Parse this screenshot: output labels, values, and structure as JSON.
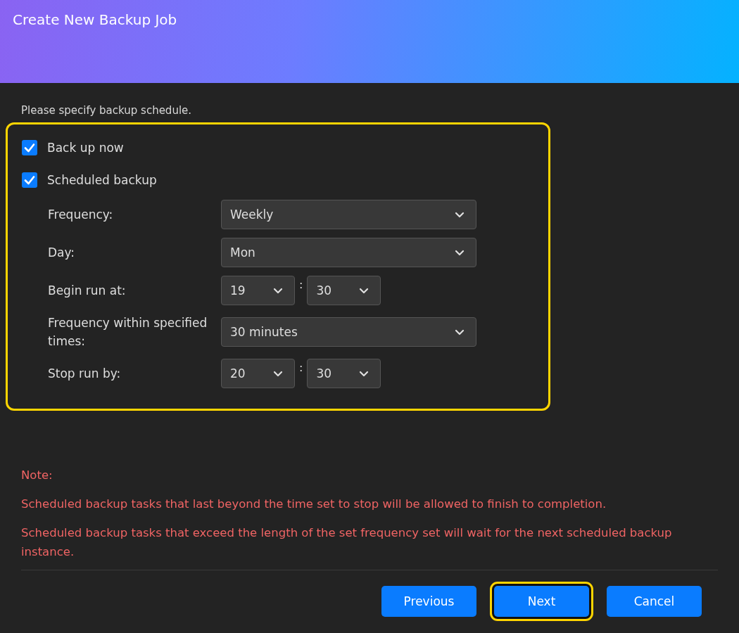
{
  "window": {
    "title": "Create New Backup Job"
  },
  "intro": "Please specify backup schedule.",
  "schedule_group": {
    "highlighted": true,
    "options": [
      {
        "label": "Back up now",
        "checked": true
      },
      {
        "label": "Scheduled backup",
        "checked": true
      }
    ],
    "fields": [
      {
        "kind": "select",
        "label": "Frequency:",
        "value": "Weekly"
      },
      {
        "kind": "select",
        "label": "Day:",
        "value": "Mon"
      },
      {
        "kind": "time",
        "label": "Begin run at:",
        "hour": "19",
        "separator": ":",
        "minute": "30"
      },
      {
        "kind": "select",
        "label": "Frequency within specified times:",
        "value": "30 minutes"
      },
      {
        "kind": "time",
        "label": "Stop run by:",
        "hour": "20",
        "separator": ":",
        "minute": "30"
      }
    ]
  },
  "note": {
    "heading": "Note:",
    "lines": [
      "Scheduled backup tasks that last beyond the time set to stop will be allowed to finish to completion.",
      "Scheduled backup tasks that exceed the length of the set frequency set will wait for the next scheduled backup instance."
    ]
  },
  "buttons": [
    {
      "label": "Previous",
      "highlighted": false
    },
    {
      "label": "Next",
      "highlighted": true
    },
    {
      "label": "Cancel",
      "highlighted": false
    }
  ]
}
